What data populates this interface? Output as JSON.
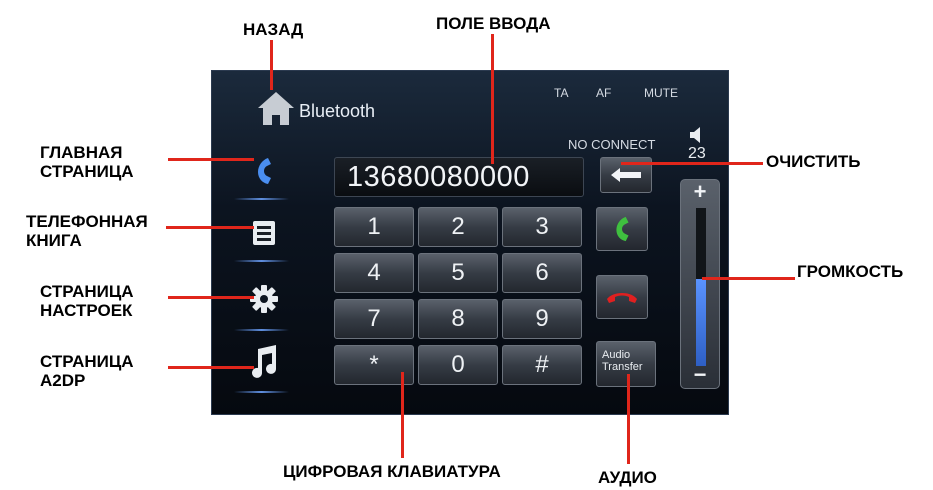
{
  "device": {
    "title": "Bluetooth",
    "status": {
      "ta": "TA",
      "af": "AF",
      "mute": "MUTE",
      "connection": "NO CONNECT"
    },
    "volume": {
      "value": "23",
      "plus": "+",
      "minus": "−",
      "level_fraction": 0.55
    },
    "display_number": "13680080000",
    "keypad": [
      {
        "label": "1"
      },
      {
        "label": "2"
      },
      {
        "label": "3"
      },
      {
        "label": "4"
      },
      {
        "label": "5"
      },
      {
        "label": "6"
      },
      {
        "label": "7"
      },
      {
        "label": "8"
      },
      {
        "label": "9"
      },
      {
        "label": "*"
      },
      {
        "label": "0"
      },
      {
        "label": "#"
      }
    ],
    "audio_transfer": {
      "line1": "Audio",
      "line2": "Transfer"
    },
    "sidebar": [
      "phone-icon",
      "phonebook-icon",
      "gear-icon",
      "music-note-icon"
    ],
    "colors": {
      "call_green": "#3fbf3f",
      "hangup_red": "#e02020",
      "accent_blue": "#4a8ef0"
    }
  },
  "callouts": {
    "back": "НАЗАД",
    "input_field": "ПОЛЕ ВВОДА",
    "main_page_1": "ГЛАВНАЯ",
    "main_page_2": "СТРАНИЦА",
    "clear": "ОЧИСТИТЬ",
    "phonebook_1": "ТЕЛЕФОННАЯ",
    "phonebook_2": "КНИГА",
    "settings_1": "СТРАНИЦА",
    "settings_2": "НАСТРОЕК",
    "volume": "ГРОМКОСТЬ",
    "a2dp_1": "СТРАНИЦА",
    "a2dp_2": "A2DP",
    "keypad": "ЦИФРОВАЯ КЛАВИАТУРА",
    "audio": "АУДИО"
  }
}
